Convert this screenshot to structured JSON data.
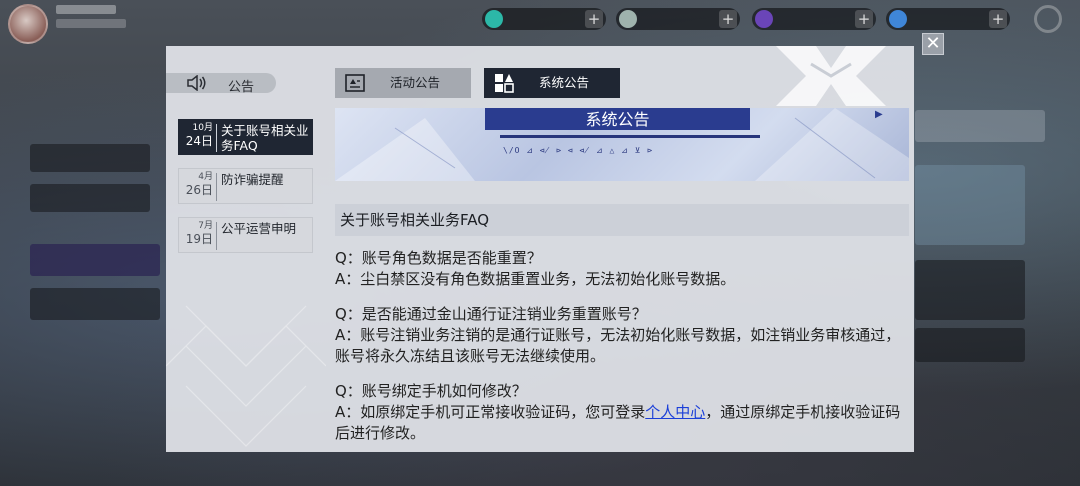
{
  "dialog": {
    "header_label": "公告",
    "close_label": "✕"
  },
  "tabs": [
    {
      "label": "活动公告",
      "icon": "notice-card-icon",
      "active": false
    },
    {
      "label": "系统公告",
      "icon": "blocks-icon",
      "active": true
    }
  ],
  "announcements": [
    {
      "month": "10月",
      "day": "24日",
      "title": "关于账号相关业务FAQ",
      "active": true
    },
    {
      "month": "4月",
      "day": "26日",
      "title": "防诈骗提醒",
      "active": false
    },
    {
      "month": "7月",
      "day": "19日",
      "title": "公平运营申明",
      "active": false
    }
  ],
  "article": {
    "banner_text": "系统公告",
    "banner_code": "\\/O ⊿ ⋪ ⊳ ⊲ ⋪ ⊿ △ ⊿ ⊻ ⊳",
    "title": "关于账号相关业务FAQ",
    "faq": [
      {
        "q": "Q：账号角色数据是否能重置？",
        "a": "A：尘白禁区没有角色数据重置业务，无法初始化账号数据。"
      },
      {
        "q": "Q：是否能通过金山通行证注销业务重置账号？",
        "a": "A：账号注销业务注销的是通行证账号，无法初始化账号数据，如注销业务审核通过，账号将永久冻结且该账号无法继续使用。"
      },
      {
        "q": "Q：账号绑定手机如何修改？",
        "a_pre": "A：如原绑定手机可正常接收验证码，您可登录",
        "a_link": "个人中心",
        "a_post": "，通过原绑定手机接收验证码后进行修改。"
      }
    ]
  },
  "colors": {
    "accent_dark": "#1f2633",
    "link": "#1b3fd8",
    "banner_blue": "#2a3c8f"
  }
}
